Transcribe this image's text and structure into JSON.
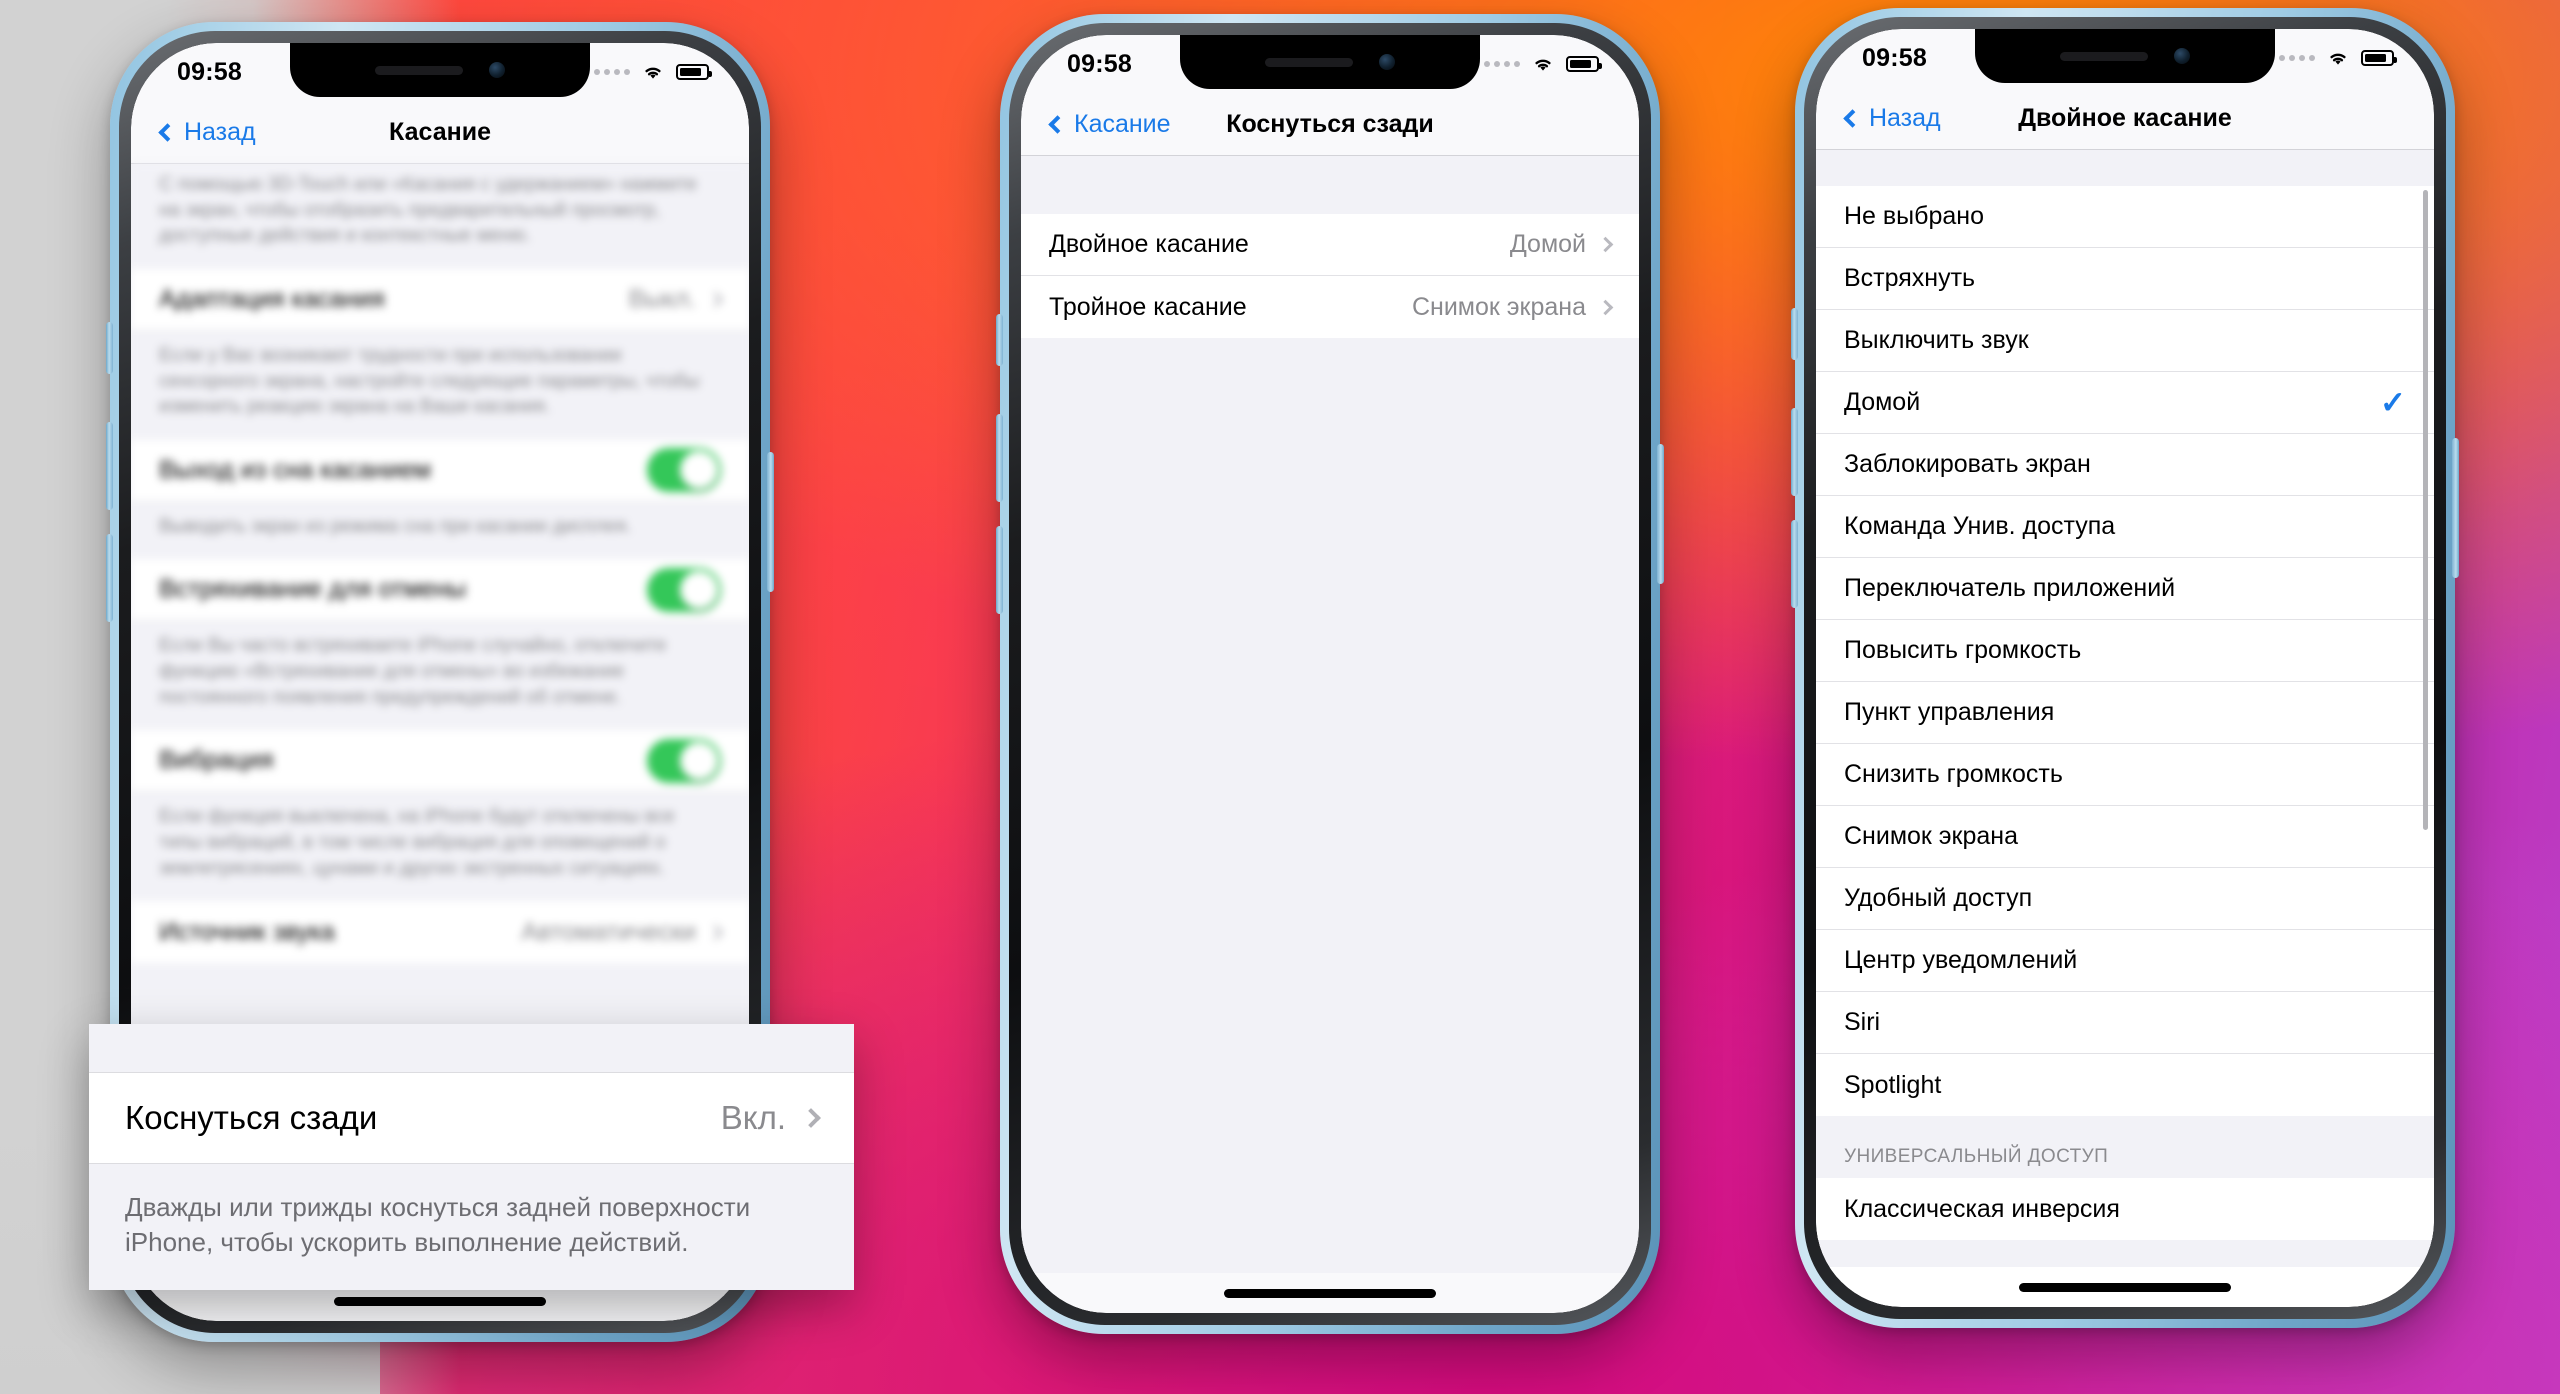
{
  "background": {
    "accent_orange": "#ff8a00",
    "accent_red": "#ff3b4e",
    "accent_magenta": "#d40b7d",
    "accent_purple": "#c44bd8",
    "gray": "#d2d2d2"
  },
  "theme": {
    "tint_blue": "#1a7ae8",
    "toggle_green": "#34c759",
    "secondary_text": "#8a8a8e",
    "group_bg": "#f2f2f7",
    "cell_bg": "#ffffff"
  },
  "status_bar": {
    "time": "09:58",
    "signal_icon": "signal-dots-icon",
    "wifi_icon": "wifi-icon",
    "battery_icon": "battery-icon"
  },
  "phone1": {
    "nav": {
      "back_label": "Назад",
      "title": "Касание"
    },
    "top_footnote": "С помощью 3D-Touch или «Касания с удержанием» нажмите на экран, чтобы отобразить предварительный просмотр, доступные действия и контекстные меню.",
    "rows": [
      {
        "label": "Адаптация касания",
        "value": "Выкл.",
        "type": "disclosure"
      }
    ],
    "footnote1": "Если у Вас возникают трудности при использовании сенсорного экрана, настройте следующие параметры, чтобы изменить реакцию экрана на Ваши касания.",
    "toggles": [
      {
        "label": "Выход из сна касанием",
        "on": true,
        "footnote": "Выводить экран из режима сна при касании дисплея."
      },
      {
        "label": "Встряхивание для отмены",
        "on": true,
        "footnote": "Если Вы часто встряхиваете iPhone случайно, отключите функцию «Встряхивание для отмены» во избежание постоянного появления предупреждений об отмене."
      },
      {
        "label": "Вибрация",
        "on": true,
        "footnote": "Если функция выключена, на iPhone будут отключены все типы вибраций, в том числе вибрация для оповещений о землетрясениях, цунами и других экстренных ситуациях."
      }
    ],
    "bottom_row": {
      "label": "Источник звука",
      "value": "Автоматически",
      "type": "disclosure"
    }
  },
  "callout": {
    "label": "Коснуться сзади",
    "value": "Вкл.",
    "chevron_icon": "chevron-right-icon",
    "description": "Дважды или трижды коснуться задней поверхности iPhone, чтобы ускорить выполнение действий."
  },
  "phone2": {
    "nav": {
      "back_label": "Касание",
      "title": "Коснуться сзади"
    },
    "rows": [
      {
        "label": "Двойное касание",
        "value": "Домой"
      },
      {
        "label": "Тройное касание",
        "value": "Снимок экрана"
      }
    ]
  },
  "phone3": {
    "nav": {
      "back_label": "Назад",
      "title": "Двойное касание"
    },
    "items": [
      {
        "label": "Не выбрано",
        "selected": false
      },
      {
        "label": "Встряхнуть",
        "selected": false
      },
      {
        "label": "Выключить звук",
        "selected": false
      },
      {
        "label": "Домой",
        "selected": true
      },
      {
        "label": "Заблокировать экран",
        "selected": false
      },
      {
        "label": "Команда Унив. доступа",
        "selected": false
      },
      {
        "label": "Переключатель приложений",
        "selected": false
      },
      {
        "label": "Повысить громкость",
        "selected": false
      },
      {
        "label": "Пункт управления",
        "selected": false
      },
      {
        "label": "Снизить громкость",
        "selected": false
      },
      {
        "label": "Снимок экрана",
        "selected": false
      },
      {
        "label": "Удобный доступ",
        "selected": false
      },
      {
        "label": "Центр уведомлений",
        "selected": false
      },
      {
        "label": "Siri",
        "selected": false
      },
      {
        "label": "Spotlight",
        "selected": false
      }
    ],
    "section_header": "УНИВЕРСАЛЬНЫЙ ДОСТУП",
    "section_items": [
      {
        "label": "Классическая инверсия",
        "selected": false
      }
    ],
    "checkmark_glyph": "✓"
  }
}
